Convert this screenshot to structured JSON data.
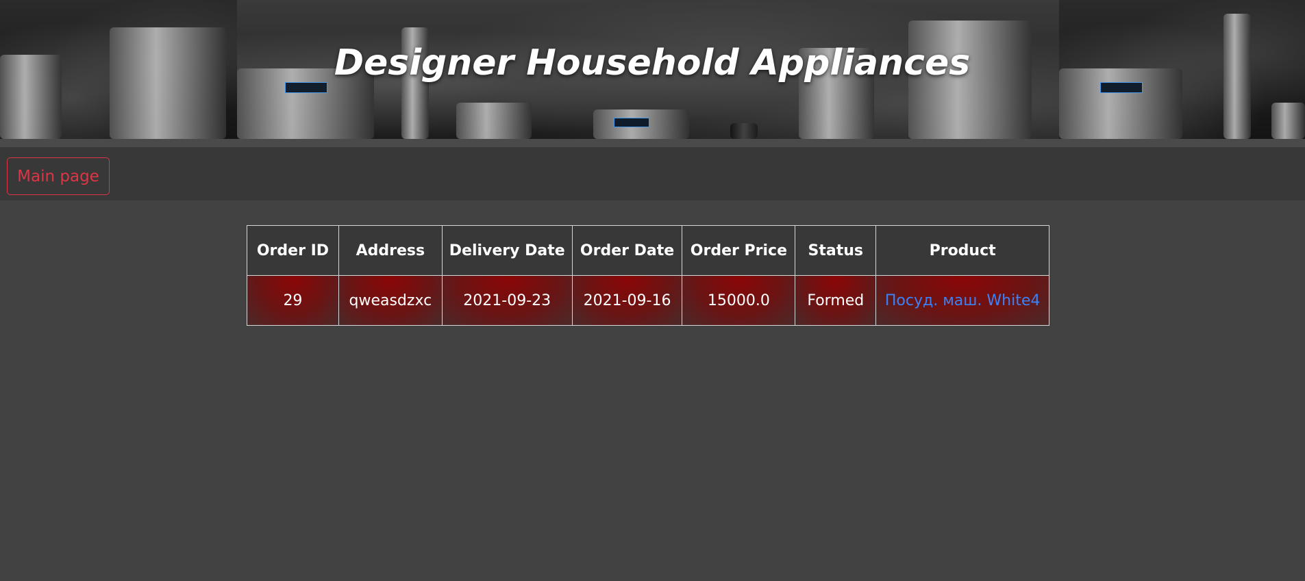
{
  "header": {
    "title": "Designer Household Appliances"
  },
  "navbar": {
    "main_page_label": "Main page"
  },
  "orders_table": {
    "columns": [
      "Order ID",
      "Address",
      "Delivery Date",
      "Order Date",
      "Order Price",
      "Status",
      "Product"
    ],
    "rows": [
      {
        "order_id": "29",
        "address": "qweasdzxc",
        "delivery_date": "2021-09-23",
        "order_date": "2021-09-16",
        "order_price": "15000.0",
        "status": "Formed",
        "product": "Посуд. маш. White4"
      }
    ]
  },
  "colors": {
    "page_background": "#424242",
    "navbar_background": "#383838",
    "main_button_accent": "#dc3545",
    "row_highlight": "#8c0606",
    "link_color": "#3b82f6"
  }
}
